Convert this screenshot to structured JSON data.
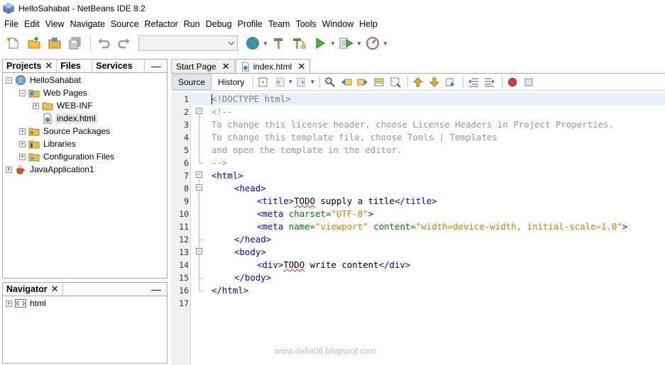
{
  "window": {
    "title": "HelloSahabat - NetBeans IDE 8.2"
  },
  "menu": [
    "File",
    "Edit",
    "View",
    "Navigate",
    "Source",
    "Refactor",
    "Run",
    "Debug",
    "Profile",
    "Team",
    "Tools",
    "Window",
    "Help"
  ],
  "projects_panel": {
    "tabs": [
      "Projects",
      "Files",
      "Services"
    ],
    "minimize": "—",
    "tree": {
      "project": "HelloSahabat",
      "web_pages": "Web Pages",
      "web_inf": "WEB-INF",
      "index_file": "index.html",
      "source_packages": "Source Packages",
      "libraries": "Libraries",
      "config_files": "Configuration Files",
      "java_app": "JavaApplication1"
    }
  },
  "navigator_panel": {
    "title": "Navigator",
    "minimize": "—",
    "root": "html"
  },
  "editor": {
    "tabs": [
      "Start Page",
      "index.html"
    ],
    "views": [
      "Source",
      "History"
    ],
    "line_numbers": [
      "1",
      "2",
      "3",
      "4",
      "5",
      "6",
      "7",
      "8",
      "9",
      "10",
      "11",
      "12",
      "13",
      "14",
      "15",
      "16",
      "17"
    ],
    "code": {
      "l1": "<!DOCTYPE html>",
      "l2": "<!--",
      "l3": "To change this license header, choose License Headers in Project Properties.",
      "l4": "To change this template file, choose Tools | Templates",
      "l5": "and open the template in the editor.",
      "l6": "-->",
      "l7": "<html>",
      "l8": "<head>",
      "l9_open": "<title>",
      "l9_todo": "TODO",
      "l9_text": " supply a title",
      "l9_close": "</title>",
      "l10_tag": "<meta",
      "l10_attr": "charset=",
      "l10_val": "\"UTF-8\"",
      "l10_end": ">",
      "l11_tag": "<meta",
      "l11_attr1": "name=",
      "l11_val1": "\"viewport\"",
      "l11_attr2": "content=",
      "l11_val2": "\"width=device-width, initial-scale=1.0\"",
      "l11_end": ">",
      "l12": "</head>",
      "l13": "<body>",
      "l14_open": "<div>",
      "l14_todo": "TODO",
      "l14_text": " write content",
      "l14_close": "</div>",
      "l15": "</body>",
      "l16": "</html>"
    }
  },
  "watermark": "www.dafia06.blogspot.com",
  "colors": {
    "tag": "#0000e6",
    "attribute": "#0b6f0b",
    "value": "#ce7b00",
    "comment": "#969696"
  }
}
